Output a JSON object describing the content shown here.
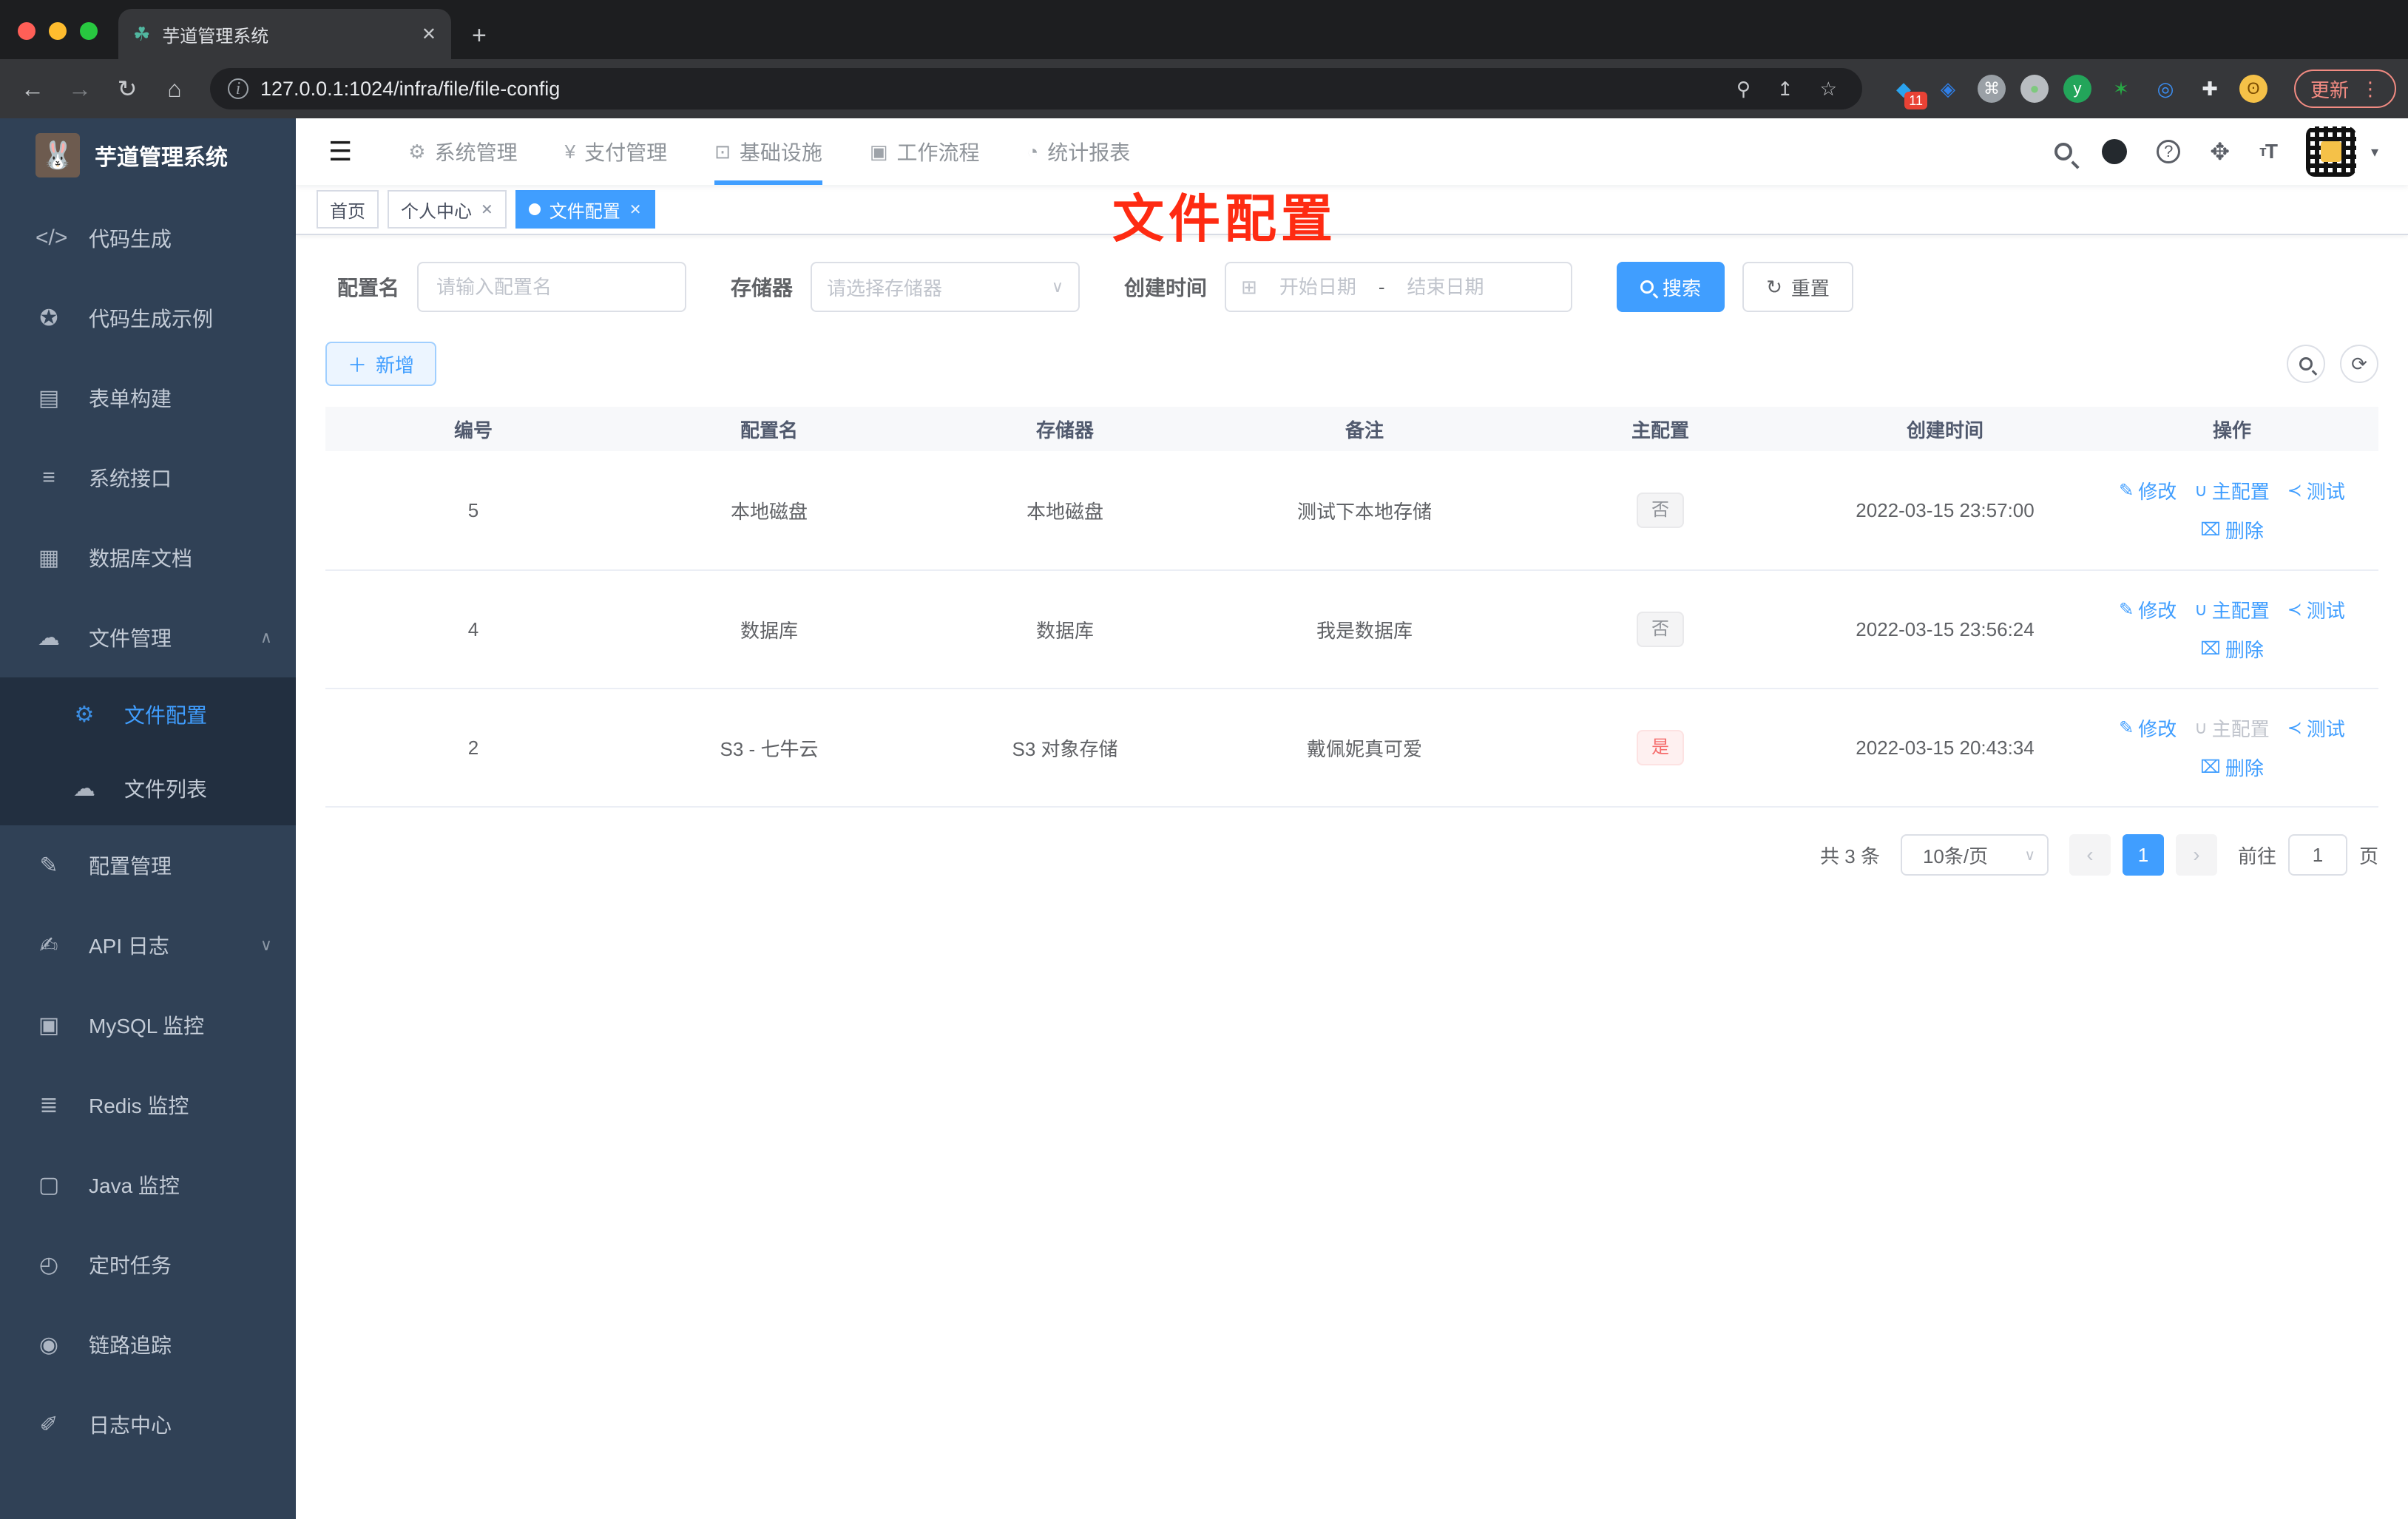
{
  "browser": {
    "tab_title": "芋道管理系统",
    "tab_close": "✕",
    "new_tab": "+",
    "url": "127.0.0.1:1024/infra/file/file-config",
    "update_label": "更新",
    "extension_badge": "11",
    "extensions": [
      "blocks-diamond-icon",
      "gem-icon",
      "command-circle-icon",
      "record-circle-icon",
      "y-circle-icon",
      "green-star-icon",
      "rings-icon",
      "puzzle-icon",
      "emoji-face-icon"
    ]
  },
  "app": {
    "title": "芋道管理系统",
    "annotation_text": "文件配置"
  },
  "top_nav": {
    "items": [
      {
        "icon": "gear-icon",
        "label": "系统管理",
        "active": false
      },
      {
        "icon": "yen-icon",
        "label": "支付管理",
        "active": false
      },
      {
        "icon": "monitor-check-icon",
        "label": "基础设施",
        "active": true
      },
      {
        "icon": "briefcase-icon",
        "label": "工作流程",
        "active": false
      },
      {
        "icon": "dashboard-icon",
        "label": "统计报表",
        "active": false
      }
    ]
  },
  "sidebar": {
    "items": [
      {
        "icon": "code-icon",
        "label": "代码生成"
      },
      {
        "icon": "shield-check-icon",
        "label": "代码生成示例"
      },
      {
        "icon": "form-icon",
        "label": "表单构建"
      },
      {
        "icon": "sliders-icon",
        "label": "系统接口"
      },
      {
        "icon": "database-doc-icon",
        "label": "数据库文档"
      },
      {
        "icon": "cloud-download-icon",
        "label": "文件管理",
        "chevron": "up"
      },
      {
        "icon": "gear-icon",
        "label": "文件配置",
        "sub": true,
        "active": true
      },
      {
        "icon": "cloud-upload-icon",
        "label": "文件列表",
        "sub": true
      },
      {
        "icon": "edit-square-icon",
        "label": "配置管理"
      },
      {
        "icon": "doc-edit-icon",
        "label": "API 日志",
        "chevron": "down"
      },
      {
        "icon": "mysql-monitor-icon",
        "label": "MySQL 监控"
      },
      {
        "icon": "layers-icon",
        "label": "Redis 监控"
      },
      {
        "icon": "java-monitor-icon",
        "label": "Java 监控"
      },
      {
        "icon": "timer-icon",
        "label": "定时任务"
      },
      {
        "icon": "eye-icon",
        "label": "链路追踪"
      },
      {
        "icon": "log-edit-icon",
        "label": "日志中心"
      }
    ]
  },
  "tags": [
    {
      "label": "首页",
      "closable": false,
      "active": false
    },
    {
      "label": "个人中心",
      "closable": true,
      "active": false
    },
    {
      "label": "文件配置",
      "closable": true,
      "active": true
    }
  ],
  "filters": {
    "name_label": "配置名",
    "name_placeholder": "请输入配置名",
    "storage_label": "存储器",
    "storage_placeholder": "请选择存储器",
    "date_label": "创建时间",
    "date_start_placeholder": "开始日期",
    "date_separator": "-",
    "date_end_placeholder": "结束日期",
    "search_label": "搜索",
    "reset_label": "重置"
  },
  "toolbar": {
    "add_label": "新增"
  },
  "table": {
    "columns": [
      "编号",
      "配置名",
      "存储器",
      "备注",
      "主配置",
      "创建时间",
      "操作"
    ],
    "action_labels": {
      "edit": "修改",
      "master": "主配置",
      "test": "测试",
      "delete": "删除"
    },
    "rows": [
      {
        "id": "5",
        "name": "本地磁盘",
        "storage": "本地磁盘",
        "remark": "测试下本地存储",
        "master": "否",
        "master_type": "info",
        "created": "2022-03-15 23:57:00",
        "master_action_disabled": false
      },
      {
        "id": "4",
        "name": "数据库",
        "storage": "数据库",
        "remark": "我是数据库",
        "master": "否",
        "master_type": "info",
        "created": "2022-03-15 23:56:24",
        "master_action_disabled": false
      },
      {
        "id": "2",
        "name": "S3 - 七牛云",
        "storage": "S3 对象存储",
        "remark": "戴佩妮真可爱",
        "master": "是",
        "master_type": "danger",
        "created": "2022-03-15 20:43:34",
        "master_action_disabled": true
      }
    ]
  },
  "pagination": {
    "total_text": "共 3 条",
    "page_size": "10条/页",
    "active_page": "1",
    "goto_label": "前往",
    "goto_value": "1",
    "page_unit": "页"
  },
  "colors": {
    "primary": "#409eff",
    "danger": "#f56c6c",
    "sidebar_bg": "#304156",
    "sidebar_sub_bg": "#222f40",
    "annotation_red": "#fe2b12"
  }
}
